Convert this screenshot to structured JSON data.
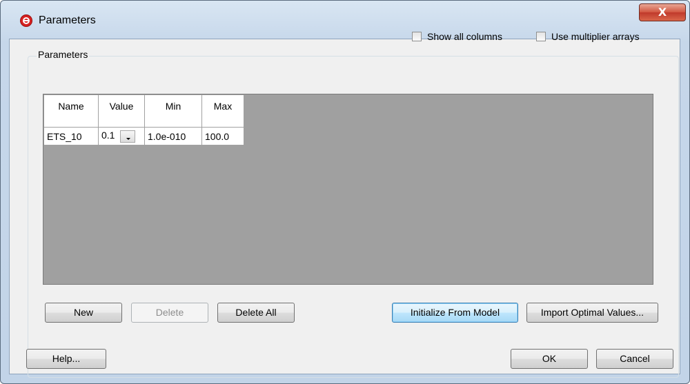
{
  "window": {
    "title": "Parameters",
    "app_icon": "app-logo-icon",
    "close_label": "X"
  },
  "group": {
    "label": "Parameters"
  },
  "options": {
    "show_all_columns": "Show all columns",
    "use_multiplier_arrays": "Use multiplier arrays",
    "show_all_checked": false,
    "multiplier_checked": false
  },
  "table": {
    "headers": [
      "Name",
      "Value",
      "Min",
      "Max"
    ],
    "rows": [
      {
        "name": "ETS_10",
        "value": "0.1",
        "min": "1.0e-010",
        "max": "100.0"
      }
    ]
  },
  "buttons": {
    "new": "New",
    "delete": "Delete",
    "delete_all": "Delete All",
    "initialize": "Initialize From Model",
    "import": "Import Optimal Values...",
    "help": "Help...",
    "ok": "OK",
    "cancel": "Cancel"
  }
}
